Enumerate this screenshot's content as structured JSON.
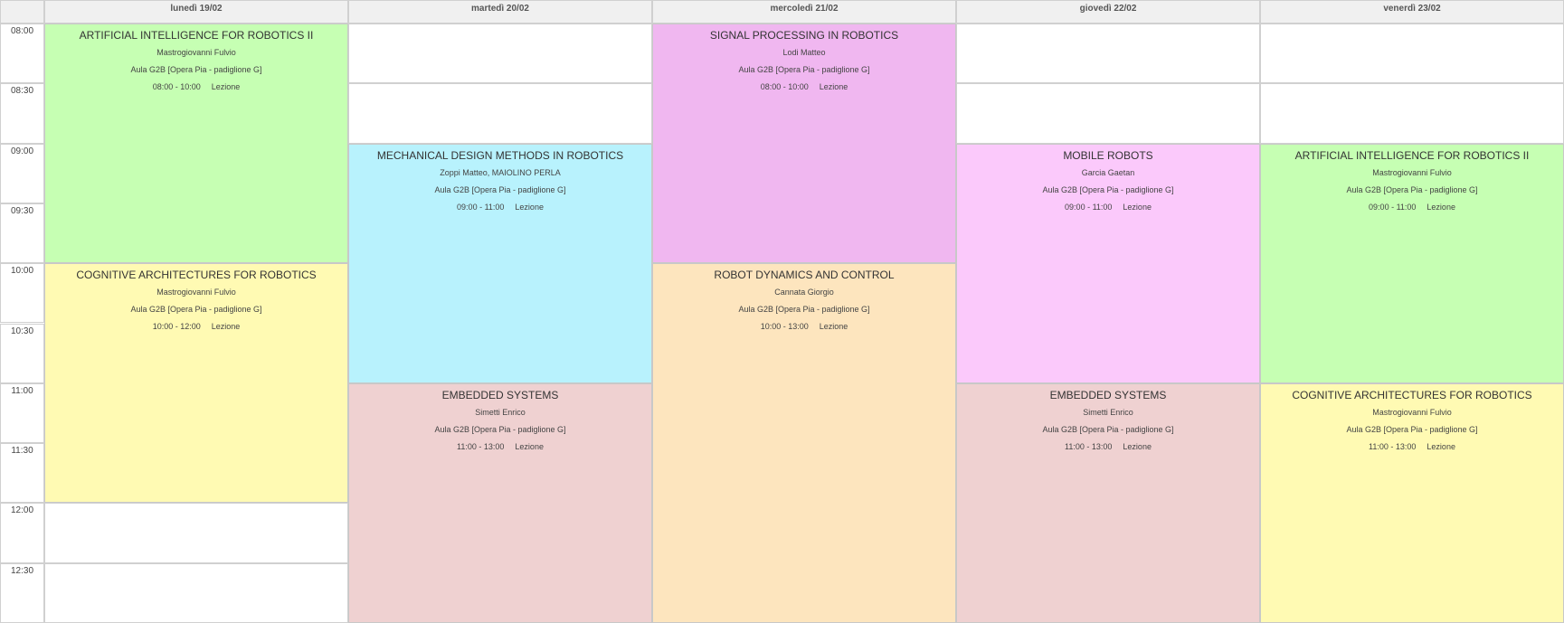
{
  "days": [
    {
      "label": "lunedì 19/02"
    },
    {
      "label": "martedì 20/02"
    },
    {
      "label": "mercoledì 21/02"
    },
    {
      "label": "giovedì 22/02"
    },
    {
      "label": "venerdì 23/02"
    }
  ],
  "times": [
    "08:00",
    "08:30",
    "09:00",
    "09:30",
    "10:00",
    "10:30",
    "11:00",
    "11:30",
    "12:00",
    "12:30"
  ],
  "colors": {
    "ai": "#c6ffb3",
    "cognitive": "#fffab3",
    "mechanical": "#b8f2fd",
    "embedded": "#efd1d1",
    "signal": "#f0b7f0",
    "dynamics": "#fde5be",
    "mobile": "#fbc9fb"
  },
  "events": [
    {
      "day": 0,
      "start": 0,
      "slots": 4,
      "color": "ai",
      "title": "ARTIFICIAL INTELLIGENCE FOR ROBOTICS II",
      "teacher": "Mastrogiovanni Fulvio",
      "room": "Aula G2B [Opera Pia - padiglione G]",
      "time": "08:00 - 10:00",
      "type": "Lezione"
    },
    {
      "day": 0,
      "start": 4,
      "slots": 4,
      "color": "cognitive",
      "title": "COGNITIVE ARCHITECTURES FOR ROBOTICS",
      "teacher": "Mastrogiovanni Fulvio",
      "room": "Aula G2B [Opera Pia - padiglione G]",
      "time": "10:00 - 12:00",
      "type": "Lezione"
    },
    {
      "day": 1,
      "start": 2,
      "slots": 4,
      "color": "mechanical",
      "title": "MECHANICAL DESIGN METHODS IN ROBOTICS",
      "teacher": "Zoppi Matteo, MAIOLINO PERLA",
      "room": "Aula G2B [Opera Pia - padiglione G]",
      "time": "09:00 - 11:00",
      "type": "Lezione"
    },
    {
      "day": 1,
      "start": 6,
      "slots": 4,
      "color": "embedded",
      "title": "EMBEDDED SYSTEMS",
      "teacher": "Simetti Enrico",
      "room": "Aula G2B [Opera Pia - padiglione G]",
      "time": "11:00 - 13:00",
      "type": "Lezione"
    },
    {
      "day": 2,
      "start": 0,
      "slots": 4,
      "color": "signal",
      "title": "SIGNAL PROCESSING IN ROBOTICS",
      "teacher": "Lodi Matteo",
      "room": "Aula G2B [Opera Pia - padiglione G]",
      "time": "08:00 - 10:00",
      "type": "Lezione"
    },
    {
      "day": 2,
      "start": 4,
      "slots": 6,
      "color": "dynamics",
      "title": "ROBOT DYNAMICS AND CONTROL",
      "teacher": "Cannata Giorgio",
      "room": "Aula G2B [Opera Pia - padiglione G]",
      "time": "10:00 - 13:00",
      "type": "Lezione"
    },
    {
      "day": 3,
      "start": 2,
      "slots": 4,
      "color": "mobile",
      "title": "MOBILE ROBOTS",
      "teacher": "Garcia Gaetan",
      "room": "Aula G2B [Opera Pia - padiglione G]",
      "time": "09:00 - 11:00",
      "type": "Lezione"
    },
    {
      "day": 3,
      "start": 6,
      "slots": 4,
      "color": "embedded",
      "title": "EMBEDDED SYSTEMS",
      "teacher": "Simetti Enrico",
      "room": "Aula G2B [Opera Pia - padiglione G]",
      "time": "11:00 - 13:00",
      "type": "Lezione"
    },
    {
      "day": 4,
      "start": 2,
      "slots": 4,
      "color": "ai",
      "title": "ARTIFICIAL INTELLIGENCE FOR ROBOTICS II",
      "teacher": "Mastrogiovanni Fulvio",
      "room": "Aula G2B [Opera Pia - padiglione G]",
      "time": "09:00 - 11:00",
      "type": "Lezione"
    },
    {
      "day": 4,
      "start": 6,
      "slots": 4,
      "color": "cognitive",
      "title": "COGNITIVE ARCHITECTURES FOR ROBOTICS",
      "teacher": "Mastrogiovanni Fulvio",
      "room": "Aula G2B [Opera Pia - padiglione G]",
      "time": "11:00 - 13:00",
      "type": "Lezione"
    }
  ]
}
